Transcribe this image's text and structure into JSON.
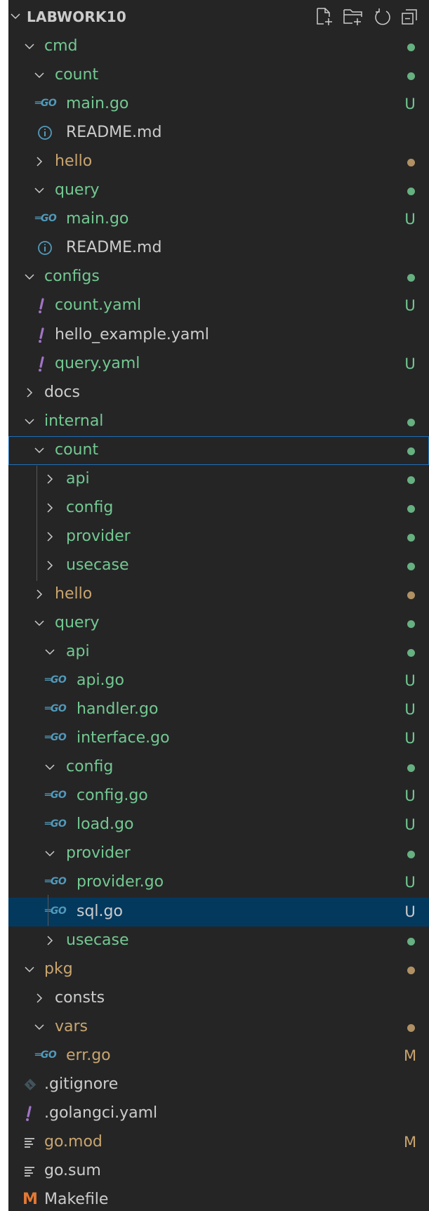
{
  "header": {
    "title": "LABWORK10",
    "actions": [
      "new-file-icon",
      "new-folder-icon",
      "refresh-icon",
      "collapse-all-icon"
    ]
  },
  "colors": {
    "background": "#252526",
    "git_untracked": "#73c991",
    "git_modified": "#c9a56e",
    "selection": "#04395e",
    "focus": "#1f6fb8",
    "go_icon": "#519aba",
    "yaml_icon": "#a074c4",
    "info_icon": "#519aba",
    "makefile_icon": "#e37933"
  },
  "tree": [
    {
      "label": "cmd",
      "type": "folder",
      "open": true,
      "depth": 1,
      "color": "green",
      "status": "dot-green"
    },
    {
      "label": "count",
      "type": "folder",
      "open": true,
      "depth": 2,
      "color": "green",
      "status": "dot-green"
    },
    {
      "label": "main.go",
      "type": "go",
      "depth": 3,
      "color": "green",
      "status": "U"
    },
    {
      "label": "README.md",
      "type": "info",
      "depth": 3,
      "color": "white",
      "status": ""
    },
    {
      "label": "hello",
      "type": "folder",
      "open": false,
      "depth": 2,
      "color": "brown",
      "status": "dot-brown"
    },
    {
      "label": "query",
      "type": "folder",
      "open": true,
      "depth": 2,
      "color": "green",
      "status": "dot-green"
    },
    {
      "label": "main.go",
      "type": "go",
      "depth": 3,
      "color": "green",
      "status": "U"
    },
    {
      "label": "README.md",
      "type": "info",
      "depth": 3,
      "color": "white",
      "status": ""
    },
    {
      "label": "configs",
      "type": "folder",
      "open": true,
      "depth": 1,
      "color": "green",
      "status": "dot-green"
    },
    {
      "label": "count.yaml",
      "type": "yaml",
      "depth": 2,
      "color": "green",
      "status": "U"
    },
    {
      "label": "hello_example.yaml",
      "type": "yaml",
      "depth": 2,
      "color": "white",
      "status": ""
    },
    {
      "label": "query.yaml",
      "type": "yaml",
      "depth": 2,
      "color": "green",
      "status": "U"
    },
    {
      "label": "docs",
      "type": "folder",
      "open": false,
      "depth": 1,
      "color": "white",
      "status": ""
    },
    {
      "label": "internal",
      "type": "folder",
      "open": true,
      "depth": 1,
      "color": "green",
      "status": "dot-green"
    },
    {
      "label": "count",
      "type": "folder",
      "open": true,
      "depth": 2,
      "color": "green",
      "status": "dot-green",
      "focused": true
    },
    {
      "label": "api",
      "type": "folder",
      "open": false,
      "depth": 3,
      "color": "green",
      "status": "dot-green"
    },
    {
      "label": "config",
      "type": "folder",
      "open": false,
      "depth": 3,
      "color": "green",
      "status": "dot-green"
    },
    {
      "label": "provider",
      "type": "folder",
      "open": false,
      "depth": 3,
      "color": "green",
      "status": "dot-green"
    },
    {
      "label": "usecase",
      "type": "folder",
      "open": false,
      "depth": 3,
      "color": "green",
      "status": "dot-green"
    },
    {
      "label": "hello",
      "type": "folder",
      "open": false,
      "depth": 2,
      "color": "brown",
      "status": "dot-brown"
    },
    {
      "label": "query",
      "type": "folder",
      "open": true,
      "depth": 2,
      "color": "green",
      "status": "dot-green"
    },
    {
      "label": "api",
      "type": "folder",
      "open": true,
      "depth": 3,
      "color": "green",
      "status": "dot-green"
    },
    {
      "label": "api.go",
      "type": "go",
      "depth": 4,
      "color": "green",
      "status": "U"
    },
    {
      "label": "handler.go",
      "type": "go",
      "depth": 4,
      "color": "green",
      "status": "U"
    },
    {
      "label": "interface.go",
      "type": "go",
      "depth": 4,
      "color": "green",
      "status": "U"
    },
    {
      "label": "config",
      "type": "folder",
      "open": true,
      "depth": 3,
      "color": "green",
      "status": "dot-green"
    },
    {
      "label": "config.go",
      "type": "go",
      "depth": 4,
      "color": "green",
      "status": "U"
    },
    {
      "label": "load.go",
      "type": "go",
      "depth": 4,
      "color": "green",
      "status": "U"
    },
    {
      "label": "provider",
      "type": "folder",
      "open": true,
      "depth": 3,
      "color": "green",
      "status": "dot-green"
    },
    {
      "label": "provider.go",
      "type": "go",
      "depth": 4,
      "color": "green",
      "status": "U"
    },
    {
      "label": "sql.go",
      "type": "go",
      "depth": 4,
      "color": "white",
      "status": "U",
      "selected": true
    },
    {
      "label": "usecase",
      "type": "folder",
      "open": false,
      "depth": 3,
      "color": "green",
      "status": "dot-green"
    },
    {
      "label": "pkg",
      "type": "folder",
      "open": true,
      "depth": 1,
      "color": "brown",
      "status": "dot-brown"
    },
    {
      "label": "consts",
      "type": "folder",
      "open": false,
      "depth": 2,
      "color": "white",
      "status": ""
    },
    {
      "label": "vars",
      "type": "folder",
      "open": true,
      "depth": 2,
      "color": "brown",
      "status": "dot-brown"
    },
    {
      "label": "err.go",
      "type": "go",
      "depth": 3,
      "color": "brown",
      "status": "M"
    },
    {
      "label": ".gitignore",
      "type": "git",
      "depth": 1,
      "color": "white",
      "status": ""
    },
    {
      "label": ".golangci.yaml",
      "type": "yaml",
      "depth": 1,
      "color": "white",
      "status": ""
    },
    {
      "label": "go.mod",
      "type": "lines",
      "depth": 1,
      "color": "brown",
      "status": "M"
    },
    {
      "label": "go.sum",
      "type": "lines",
      "depth": 1,
      "color": "white",
      "status": ""
    },
    {
      "label": "Makefile",
      "type": "makefile",
      "depth": 1,
      "color": "white",
      "status": ""
    }
  ]
}
